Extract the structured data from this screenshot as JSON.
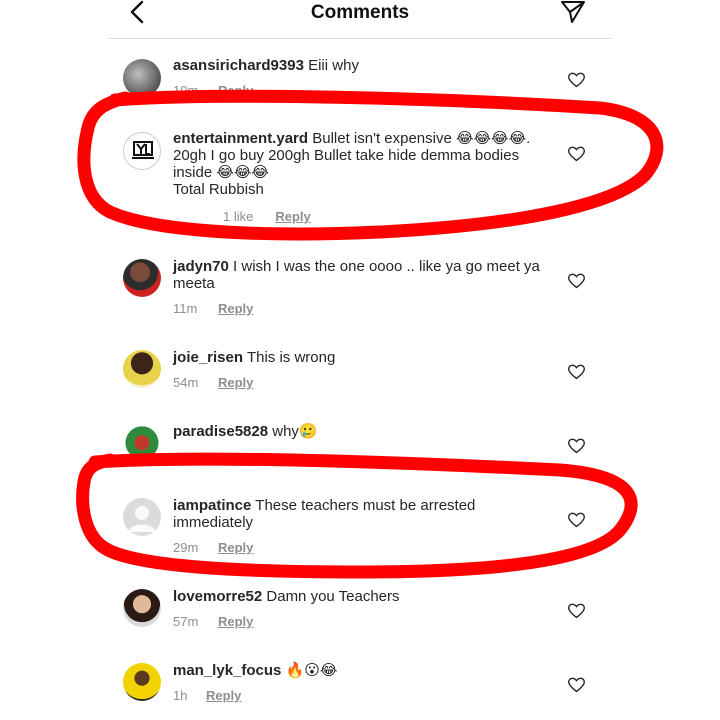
{
  "header": {
    "title": "Comments"
  },
  "comments": [
    {
      "username": "asansirichard9393",
      "text": "Eiii why",
      "time": "10m",
      "likes": "",
      "reply": "Reply"
    },
    {
      "username": "entertainment.yard",
      "text": "Bullet isn't expensive 😂😂😂😂. 20gh I go buy 200gh Bullet take hide demma bodies inside 😂😂😂\nTotal Rubbish",
      "time": "",
      "likes": "1 like",
      "reply": "Reply"
    },
    {
      "username": "jadyn70",
      "text": "I wish I was the one oooo .. like ya go meet ya meeta",
      "time": "11m",
      "likes": "",
      "reply": "Reply"
    },
    {
      "username": "joie_risen",
      "text": "This is wrong",
      "time": "54m",
      "likes": "",
      "reply": "Reply"
    },
    {
      "username": "paradise5828",
      "text": "why🥲",
      "time": "",
      "likes": "",
      "reply": ""
    },
    {
      "username": "iampatince",
      "text": "These teachers must be arrested immediately",
      "time": "29m",
      "likes": "",
      "reply": "Reply"
    },
    {
      "username": "lovemorre52",
      "text": "Damn you Teachers",
      "time": "57m",
      "likes": "",
      "reply": "Reply"
    },
    {
      "username": "man_lyk_focus",
      "text": "🔥😮😂",
      "time": "1h",
      "likes": "",
      "reply": "Reply"
    }
  ],
  "icons": {
    "back": "back-arrow-icon",
    "send": "send-icon",
    "heart": "heart-icon"
  },
  "colors": {
    "annotation": "#ff0000",
    "meta_gray": "#8e8e8e",
    "text": "#262626"
  }
}
